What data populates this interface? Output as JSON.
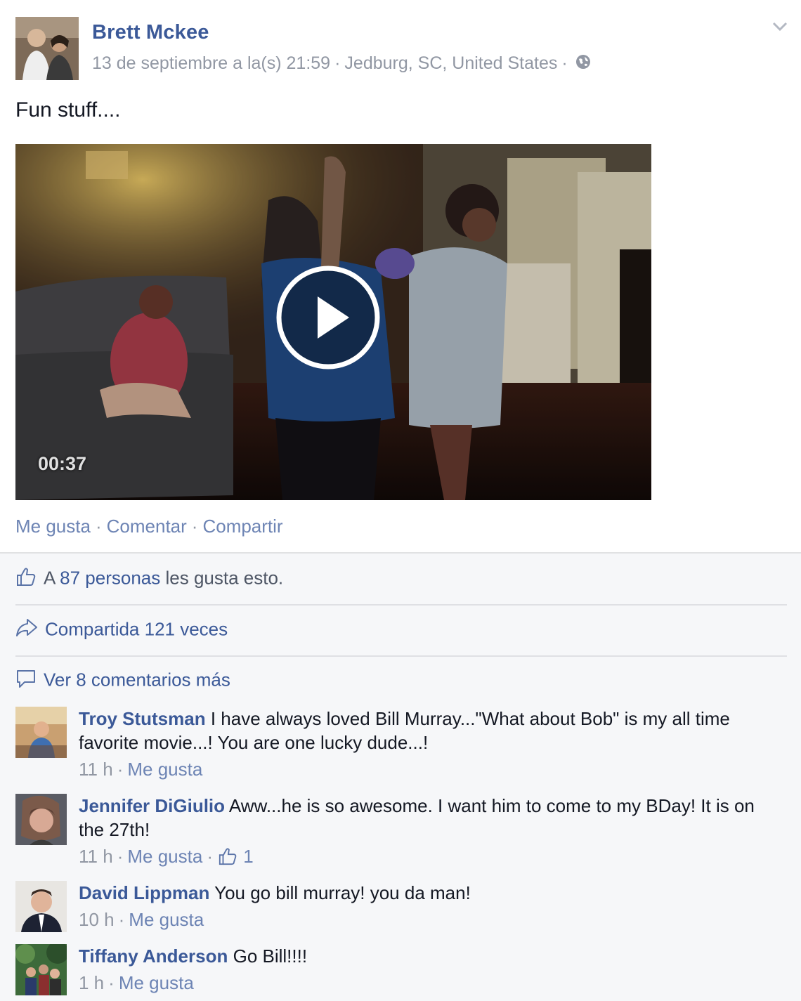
{
  "post": {
    "author": "Brett Mckee",
    "date": "13 de septiembre a la(s) 21:59",
    "location": "Jedburg, SC, United States",
    "text": "Fun stuff....",
    "video_duration": "00:37",
    "privacy_icon": "globe-icon"
  },
  "actions": {
    "like": "Me gusta",
    "comment": "Comentar",
    "share": "Compartir"
  },
  "summary": {
    "likes_prefix": "A",
    "likes_link": "87 personas",
    "likes_suffix": "les gusta esto.",
    "shares": "Compartida 121 veces",
    "more_comments": "Ver 8 comentarios más"
  },
  "comments": [
    {
      "name": "Troy Stutsman",
      "text": "I have always loved Bill Murray...\"What about Bob\" is my all time favorite movie...! You are one lucky dude...!",
      "time": "11 h",
      "like": "Me gusta",
      "likes": ""
    },
    {
      "name": "Jennifer DiGiulio",
      "text": "Aww...he is so awesome. I want him to come to my BDay! It is on the 27th!",
      "time": "11 h",
      "like": "Me gusta",
      "likes": "1"
    },
    {
      "name": "David Lippman",
      "text": "You go bill murray! you da man!",
      "time": "10 h",
      "like": "Me gusta",
      "likes": ""
    },
    {
      "name": "Tiffany Anderson",
      "text": "Go Bill!!!!",
      "time": "1 h",
      "like": "Me gusta",
      "likes": ""
    }
  ],
  "colors": {
    "link": "#3b5998",
    "meta": "#9197a3",
    "ufi_bg": "#f6f7f9"
  }
}
